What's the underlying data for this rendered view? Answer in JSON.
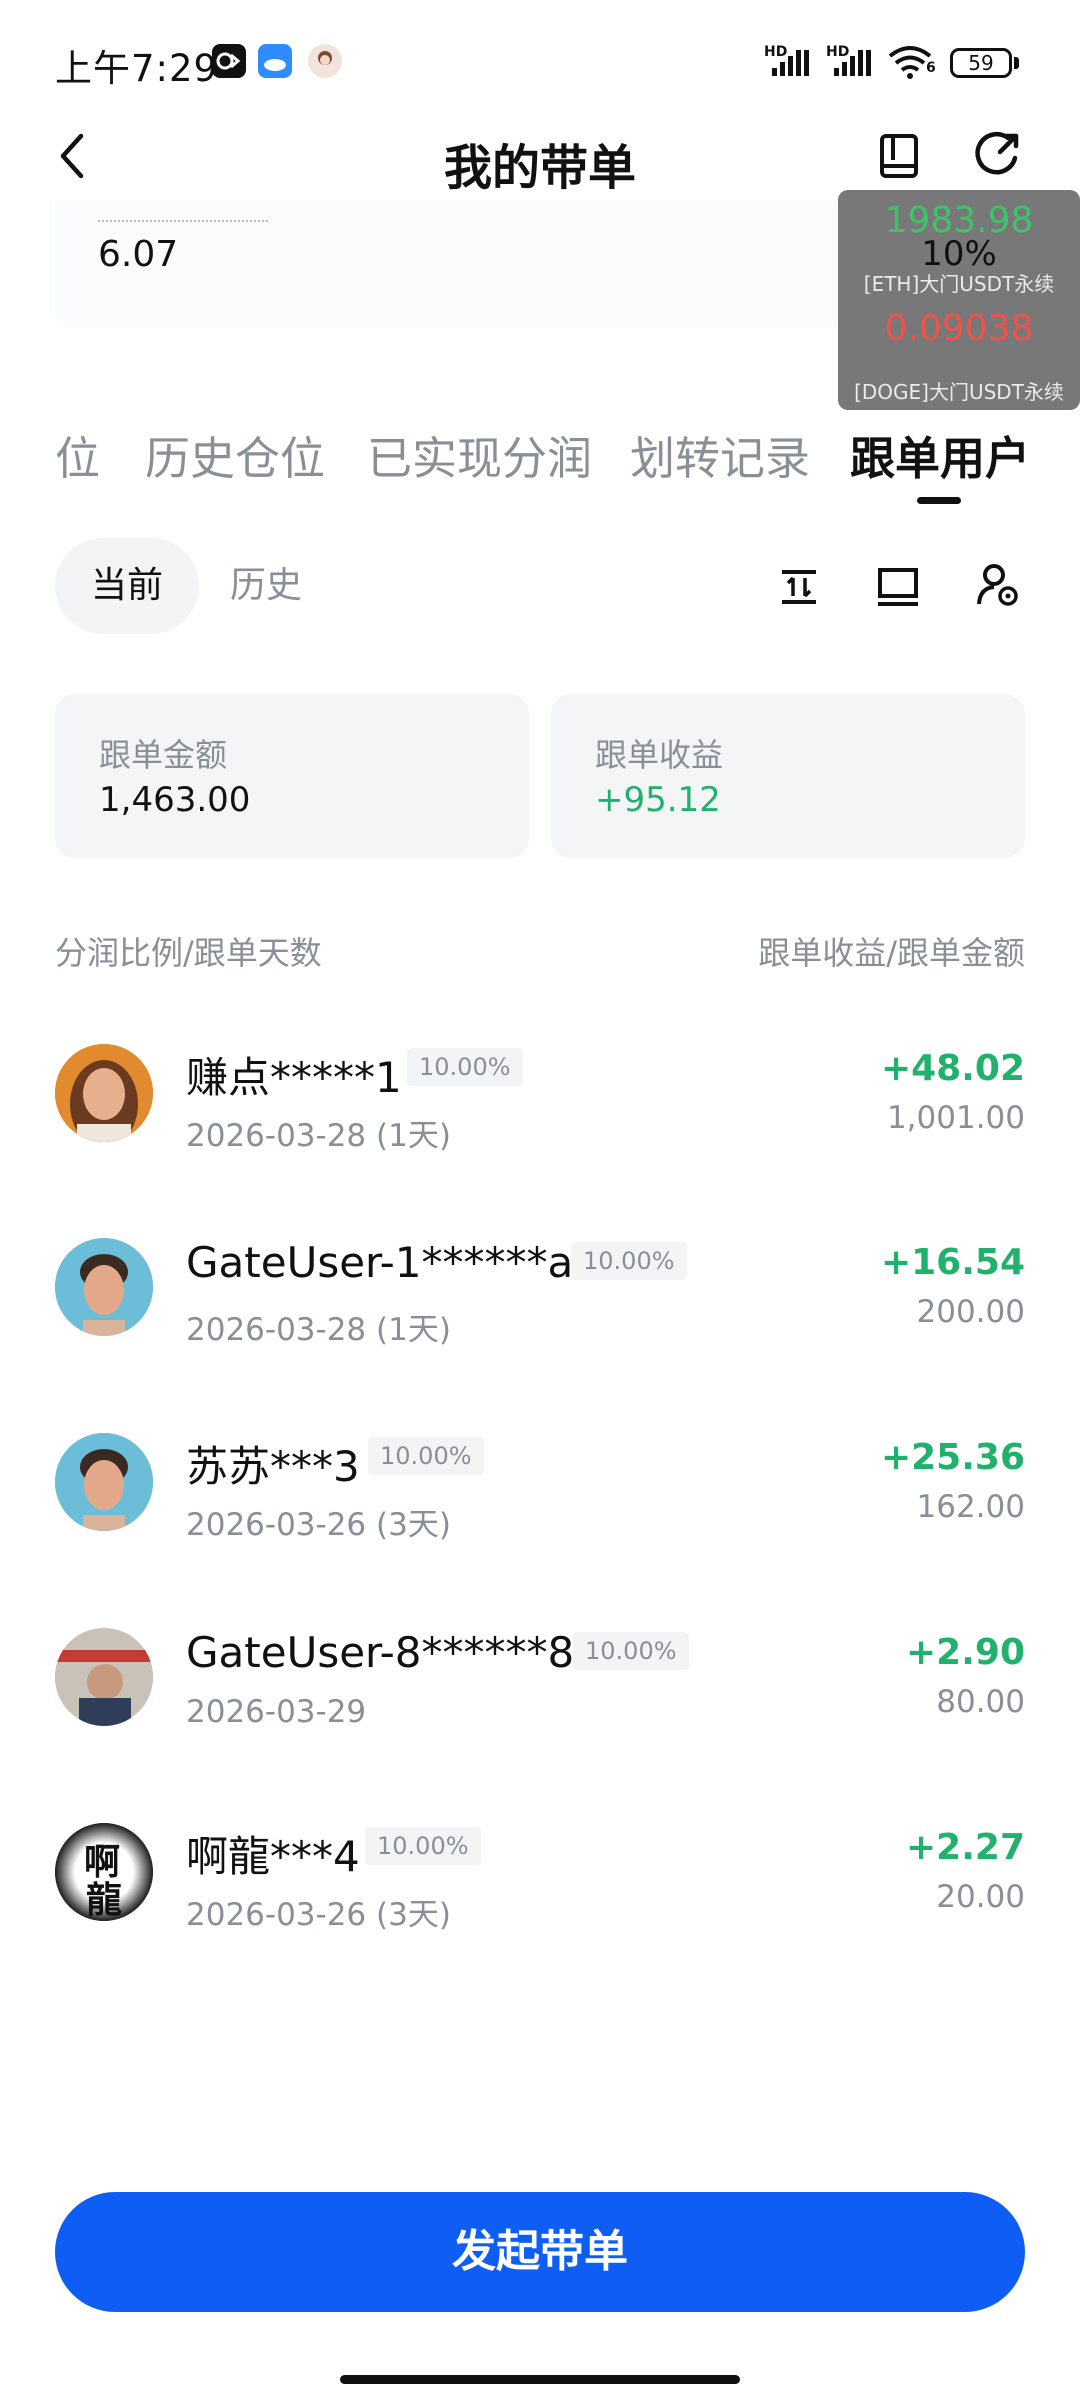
{
  "status_bar": {
    "time": "上午7:29",
    "network1": "HD",
    "network2": "HD",
    "wifi_badge": "6",
    "battery": "59"
  },
  "header": {
    "title": "我的带单",
    "back_icon": "chevron-left-icon",
    "book_icon": "book-icon",
    "share_icon": "share-icon"
  },
  "top_card": {
    "value": "6.07"
  },
  "overlay": {
    "price1": "1983.98",
    "percent": "10%",
    "label1": "[ETH]大门USDT永续",
    "price2": "0.09038",
    "label2": "[DOGE]大门USDT永续"
  },
  "tabs": [
    {
      "label": "位"
    },
    {
      "label": "历史仓位"
    },
    {
      "label": "已实现分润"
    },
    {
      "label": "划转记录"
    },
    {
      "label": "跟单用户"
    }
  ],
  "segment": {
    "current": "当前",
    "history": "历史"
  },
  "stats": {
    "amount_label": "跟单金额",
    "amount_value": "1,463.00",
    "profit_label": "跟单收益",
    "profit_value": "+95.12"
  },
  "columns": {
    "left": "分润比例/跟单天数",
    "right": "跟单收益/跟单金额"
  },
  "users": [
    {
      "name": "赚点*****1",
      "ratio": "10.00%",
      "date": "2026-03-28 (1天)",
      "profit": "+48.02",
      "amount": "1,001.00"
    },
    {
      "name": "GateUser-1******a",
      "ratio": "10.00%",
      "date": "2026-03-28 (1天)",
      "profit": "+16.54",
      "amount": "200.00"
    },
    {
      "name": "苏苏***3",
      "ratio": "10.00%",
      "date": "2026-03-26 (3天)",
      "profit": "+25.36",
      "amount": "162.00"
    },
    {
      "name": "GateUser-8******8",
      "ratio": "10.00%",
      "date": "2026-03-29",
      "profit": "+2.90",
      "amount": "80.00"
    },
    {
      "name": "啊龍***4",
      "ratio": "10.00%",
      "date": "2026-03-26 (3天)",
      "profit": "+2.27",
      "amount": "20.00"
    }
  ],
  "avatar_text": {
    "row5_top": "啊",
    "row5_bottom": "龍"
  },
  "cta": {
    "label": "发起带单"
  },
  "colors": {
    "accent": "#0e5ef5",
    "profit_green": "#20b26c",
    "muted": "#8a8f97",
    "down_red": "#f0524a"
  }
}
